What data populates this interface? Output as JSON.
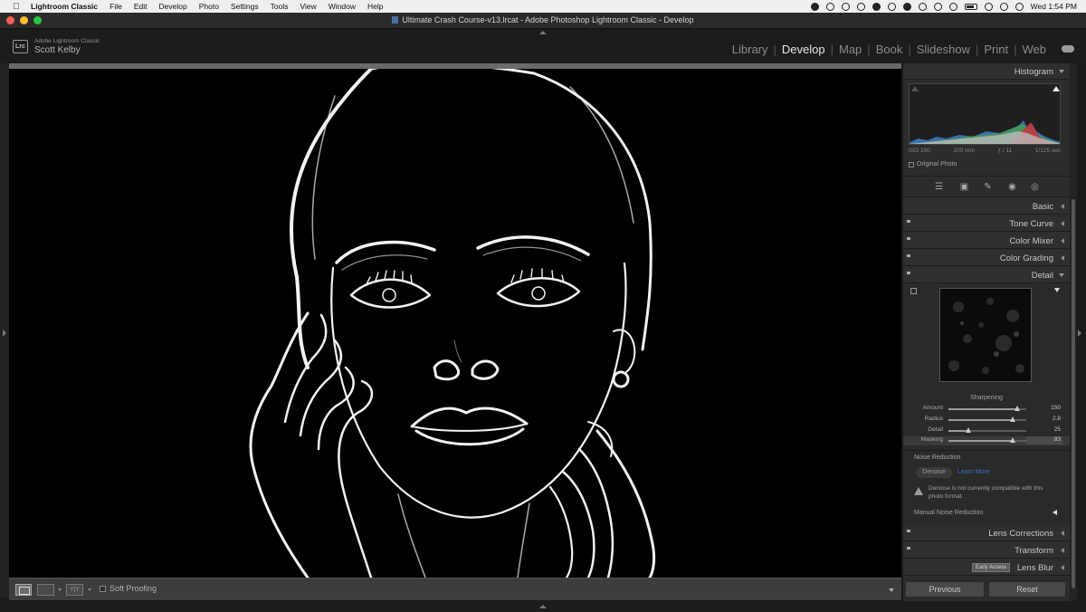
{
  "menubar": {
    "app_name": "Lightroom Classic",
    "items": [
      "File",
      "Edit",
      "Develop",
      "Photo",
      "Settings",
      "Tools",
      "View",
      "Window",
      "Help"
    ],
    "clock": "Wed 1:54 PM"
  },
  "window": {
    "title": "Ultimate Crash Course-v13.lrcat - Adobe Photoshop Lightroom Classic - Develop"
  },
  "identity": {
    "badge": "Lrc",
    "product": "Adobe Lightroom Classic",
    "user": "Scott Kelby"
  },
  "modules": [
    {
      "label": "Library",
      "active": false
    },
    {
      "label": "Develop",
      "active": true
    },
    {
      "label": "Map",
      "active": false
    },
    {
      "label": "Book",
      "active": false
    },
    {
      "label": "Slideshow",
      "active": false
    },
    {
      "label": "Print",
      "active": false
    },
    {
      "label": "Web",
      "active": false
    }
  ],
  "histogram": {
    "title": "Histogram",
    "iso": "ISO 100",
    "focal": "200 mm",
    "aperture": "ƒ / 11",
    "shutter": "1/125 sec",
    "original_photo_label": "Original Photo"
  },
  "panels": {
    "basic": "Basic",
    "tone_curve": "Tone Curve",
    "color_mixer": "Color Mixer",
    "color_grading": "Color Grading",
    "detail": "Detail",
    "lens_corrections": "Lens Corrections",
    "transform": "Transform",
    "lens_blur": "Lens Blur",
    "early_access": "Early Access"
  },
  "sharpening": {
    "title": "Sharpening",
    "sliders": [
      {
        "label": "Amount",
        "value": "150",
        "fraction": 0.88
      },
      {
        "label": "Radius",
        "value": "2.8",
        "fraction": 0.82
      },
      {
        "label": "Detail",
        "value": "25",
        "fraction": 0.25
      },
      {
        "label": "Masking",
        "value": "83",
        "fraction": 0.83
      }
    ]
  },
  "noise_reduction": {
    "title": "Noise Reduction",
    "denoise_label": "Denoise",
    "learn_more": "Learn More",
    "warning": "Denoise is not currently compatible with this photo format.",
    "manual": "Manual Noise Reduction"
  },
  "toolbar": {
    "soft_proofing": "Soft Proofing"
  },
  "buttons": {
    "previous": "Previous",
    "reset": "Reset"
  }
}
